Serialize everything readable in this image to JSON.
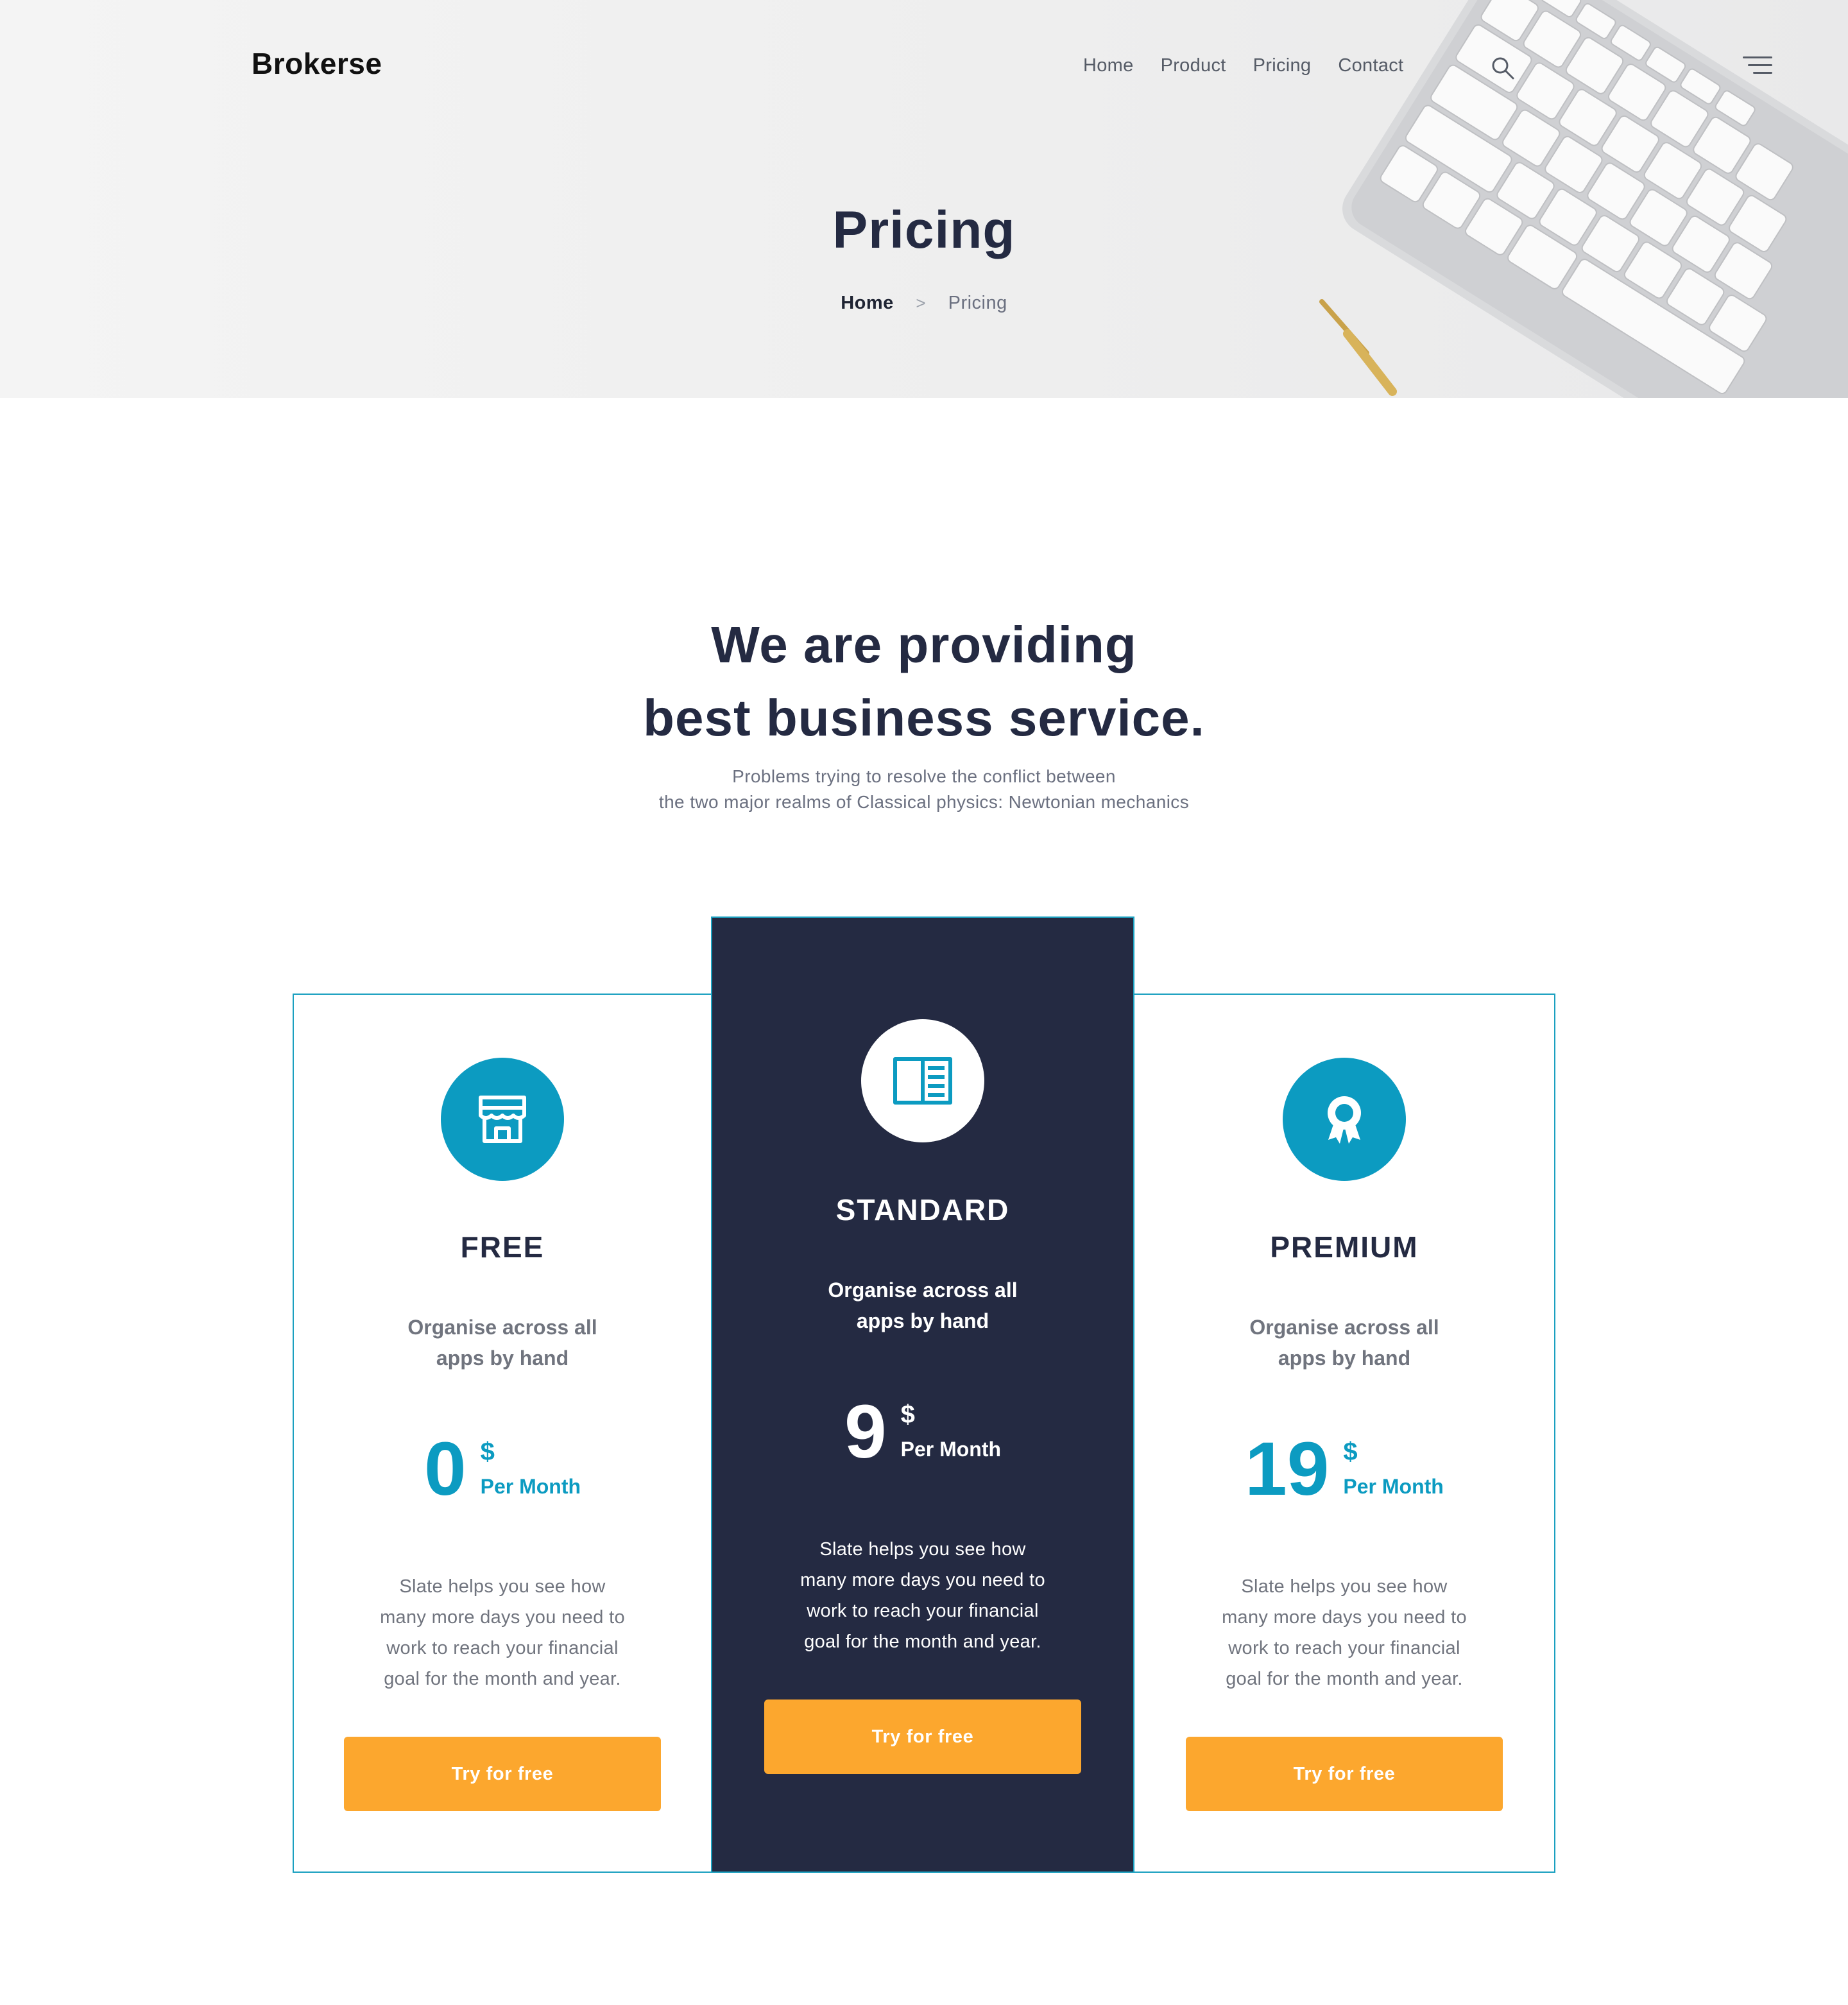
{
  "header": {
    "brand": "Brokerse",
    "nav": [
      "Home",
      "Product",
      "Pricing",
      "Contact"
    ],
    "search_icon": "search-icon",
    "menu_icon": "hamburger-menu-icon"
  },
  "hero": {
    "title": "Pricing",
    "breadcrumb": {
      "home": "Home",
      "separator": ">",
      "current": "Pricing"
    }
  },
  "section": {
    "headline_line1": "We are providing",
    "headline_line2": "best business service.",
    "subline_line1": "Problems trying to resolve the conflict between",
    "subline_line2": "the two major realms of Classical physics: Newtonian mechanics"
  },
  "plans": [
    {
      "name": "FREE",
      "icon": "store-icon",
      "tagline_line1": "Organise across all",
      "tagline_line2": "apps by hand",
      "price": "0",
      "currency": "$",
      "period": "Per Month",
      "desc_line1": "Slate helps you see how",
      "desc_line2": "many more days you need to",
      "desc_line3": "work to reach your financial",
      "desc_line4": "goal for the month and year.",
      "cta": "Try for free"
    },
    {
      "name": "STANDARD",
      "icon": "book-icon",
      "tagline_line1": "Organise across all",
      "tagline_line2": "apps by hand",
      "price": "9",
      "currency": "$",
      "period": "Per Month",
      "desc_line1": "Slate helps you see how",
      "desc_line2": "many more days you need to",
      "desc_line3": "work to reach your financial",
      "desc_line4": "goal for the month and year.",
      "cta": "Try for free"
    },
    {
      "name": "PREMIUM",
      "icon": "award-ribbon-icon",
      "tagline_line1": "Organise across all",
      "tagline_line2": "apps by hand",
      "price": "19",
      "currency": "$",
      "period": "Per Month",
      "desc_line1": "Slate helps you see how",
      "desc_line2": "many more days you need to",
      "desc_line3": "work to reach your financial",
      "desc_line4": "goal for the month and year.",
      "cta": "Try for free"
    }
  ],
  "colors": {
    "accent": "#0c9bc1",
    "dark": "#242a42",
    "button": "#fca72e",
    "muted_text": "#70747e"
  }
}
